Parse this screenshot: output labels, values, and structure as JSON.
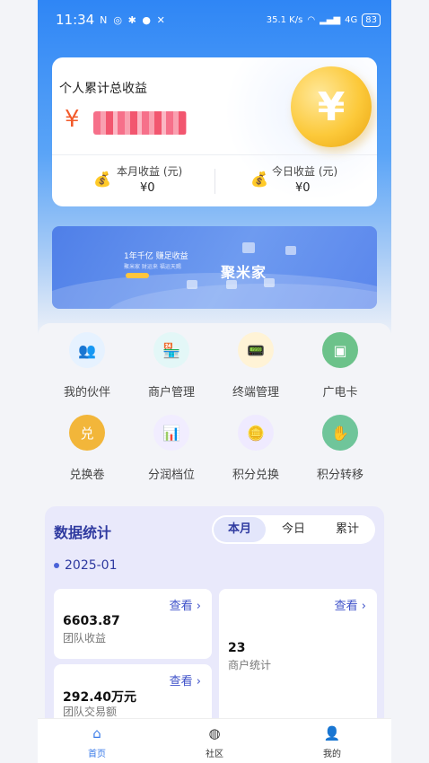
{
  "status_bar": {
    "time": "11:34",
    "net_speed": "35.1 K/s",
    "network_type": "4G",
    "battery": "83"
  },
  "earnings": {
    "title": "个人累计总收益",
    "currency_symbol": "¥",
    "monthly": {
      "label": "本月收益 (元)",
      "value": "¥0"
    },
    "daily": {
      "label": "今日收益 (元)",
      "value": "¥0"
    }
  },
  "banner": {
    "headline": "1年千亿  赚足收益",
    "subline": "聚米家   财运来   福运天赐",
    "brand": "聚米家"
  },
  "menu": {
    "items": [
      {
        "label": "我的伙伴",
        "icon": "partners-icon",
        "color": "#e6f2ff",
        "glyph": "👥"
      },
      {
        "label": "商户管理",
        "icon": "store-icon",
        "color": "#e3f7f7",
        "glyph": "🏪"
      },
      {
        "label": "终端管理",
        "icon": "terminal-icon",
        "color": "#fff3d6",
        "glyph": "📟"
      },
      {
        "label": "广电卡",
        "icon": "sim-card-icon",
        "color": "#6cc28a",
        "glyph": "▣"
      },
      {
        "label": "兑换卷",
        "icon": "exchange-coupon-icon",
        "color": "#f2b63a",
        "glyph": "兑"
      },
      {
        "label": "分润档位",
        "icon": "profit-level-icon",
        "color": "#f1edff",
        "glyph": "📊"
      },
      {
        "label": "积分兑换",
        "icon": "points-exchange-icon",
        "color": "#efeaff",
        "glyph": "🪙"
      },
      {
        "label": "积分转移",
        "icon": "points-transfer-icon",
        "color": "#6fc59a",
        "glyph": "✋"
      }
    ]
  },
  "stats": {
    "title": "数据统计",
    "tabs": [
      "本月",
      "今日",
      "累计"
    ],
    "active_tab": "本月",
    "month": "2025-01",
    "view_label": "查看 ›",
    "team_income": {
      "value": "6603.87",
      "label": "团队收益"
    },
    "merchants": {
      "value": "23",
      "label": "商户统计"
    },
    "team_volume": {
      "value": "292.40万元",
      "label": "团队交易额"
    }
  },
  "tabbar": {
    "home": "首页",
    "community": "社区",
    "mine": "我的"
  },
  "colors": {
    "accent": "#3a7be8",
    "stats_title": "#2f3aa0",
    "amount_red": "#f25a2a"
  }
}
